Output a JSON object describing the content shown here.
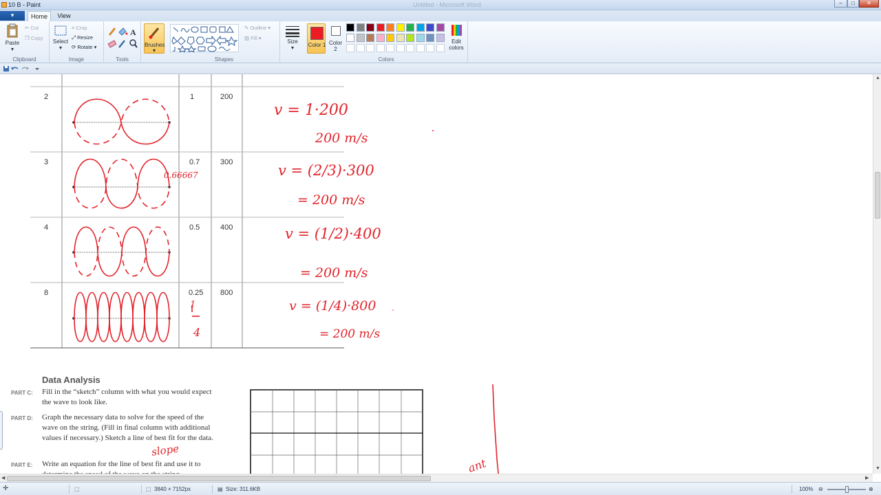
{
  "window": {
    "title": "10 B - Paint",
    "faded_title": "Untitled - Microsoft Word"
  },
  "tabs": {
    "file": "▾",
    "home": "Home",
    "view": "View"
  },
  "ribbon": {
    "clipboard": {
      "paste": "Paste",
      "cut": "Cut",
      "copy": "Copy",
      "label": "Clipboard"
    },
    "image": {
      "select": "Select",
      "crop": "Crop",
      "resize": "Resize",
      "rotate": "Rotate",
      "label": "Image"
    },
    "tools": {
      "label": "Tools"
    },
    "brushes": {
      "label": "Brushes"
    },
    "shapes": {
      "outline": "Outline",
      "fill": "Fill",
      "label": "Shapes"
    },
    "size": {
      "label": "Size"
    },
    "colors": {
      "color1": "Color 1",
      "color2": "Color 2",
      "edit": "Edit colors",
      "label": "Colors",
      "active_color": "#ed1c24",
      "palette_row1": [
        "#000000",
        "#7f7f7f",
        "#880015",
        "#ed1c24",
        "#ff7f27",
        "#fff200",
        "#22b14c",
        "#00a2e8",
        "#3f48cc",
        "#a349a4"
      ],
      "palette_row2": [
        "#ffffff",
        "#c3c3c3",
        "#b97a57",
        "#ffaec9",
        "#ffc90e",
        "#efe4b0",
        "#b5e61d",
        "#99d9ea",
        "#7092be",
        "#c8bfe7"
      ]
    }
  },
  "table": {
    "rows": [
      {
        "n": "2",
        "fraction": "1",
        "freq": "200"
      },
      {
        "n": "3",
        "fraction": "0.7",
        "freq": "300"
      },
      {
        "n": "4",
        "fraction": "0.5",
        "freq": "400"
      },
      {
        "n": "8",
        "fraction": "0.25",
        "freq": "800"
      }
    ]
  },
  "document": {
    "heading": "Data Analysis",
    "parts": [
      {
        "label": "PART C:",
        "text": "Fill in the “sketch” column with what you would expect the wave to look like."
      },
      {
        "label": "PART D:",
        "text": "Graph the necessary data to solve for the speed of the wave on the string. (Fill in final column with additional values if necessary.) Sketch a line of best fit for the data."
      },
      {
        "label": "PART E:",
        "text": "Write an equation for the line of best fit and use it to determine the speed of the wave on the string."
      }
    ]
  },
  "handwriting": {
    "eq1a": "v = 1·200",
    "eq1b": "200 m/s",
    "eq2a": "v = (2/3)·300",
    "eq2b": "= 200 m/s",
    "eq3a": "v = (1/2)·400",
    "eq3b": "= 200 m/s",
    "eq4a": "v = (1/4)·800",
    "eq4b": "= 200 m/s",
    "row3_note": "0.66667",
    "row8_frac_num": "1",
    "row8_frac_den": "4",
    "slope": "slope",
    "side_note": "ant"
  },
  "status": {
    "dimensions": "3840 × 7152px",
    "size": "Size: 311.6KB",
    "zoom": "100%"
  }
}
